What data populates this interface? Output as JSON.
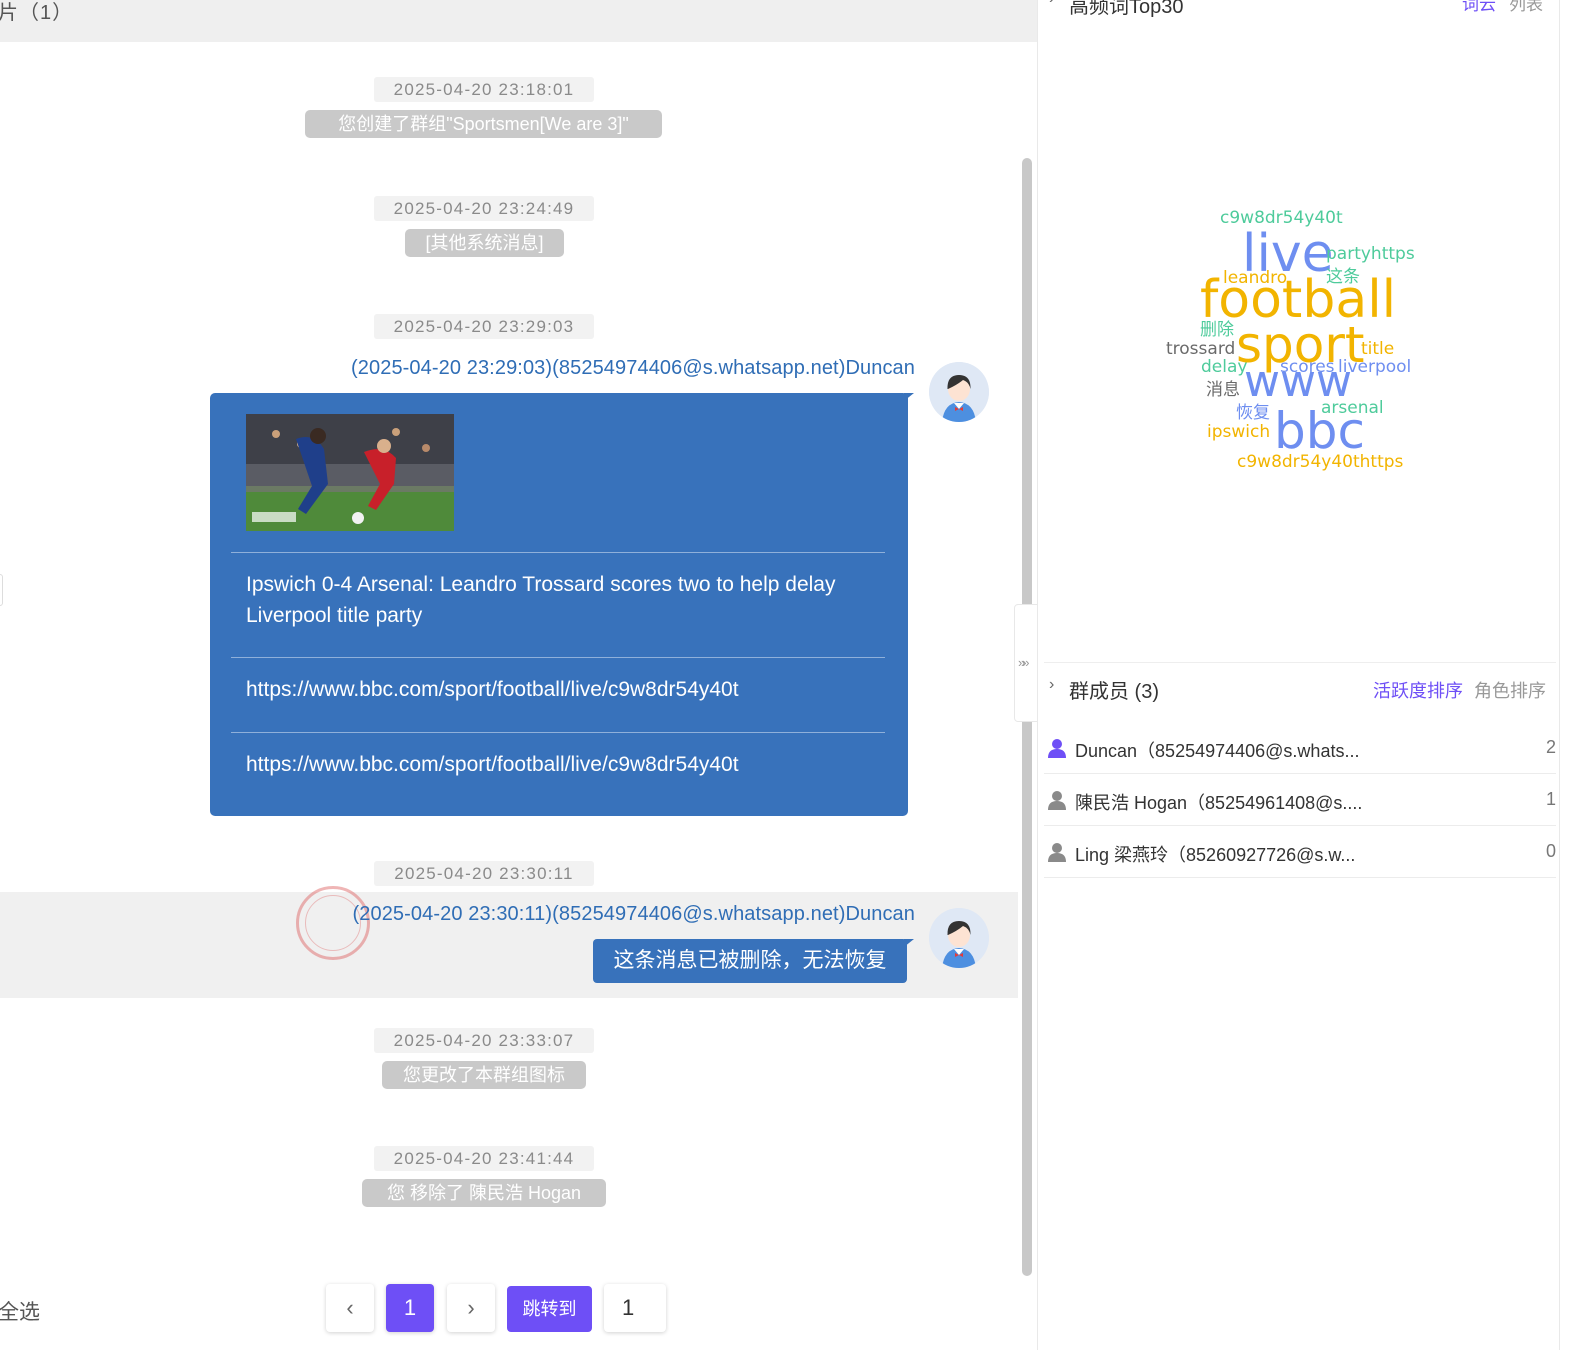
{
  "chat": {
    "header_text": "片（1）",
    "collapse_glyph": "»»",
    "messages": [
      {
        "time": "2025-04-20 23:18:01",
        "system": "您创建了群组\"Sportsmen[We are 3]\""
      },
      {
        "time": "2025-04-20 23:24:49",
        "system": "[其他系统消息]"
      },
      {
        "time": "2025-04-20 23:29:03",
        "sender": "(2025-04-20 23:29:03)(85254974406@s.whatsapp.net)Duncan",
        "link_card": {
          "title": "Ipswich 0-4 Arsenal: Leandro Trossard scores two to help delay Liverpool title party",
          "url_1": "https://www.bbc.com/sport/football/live/c9w8dr54y40t",
          "url_2": "https://www.bbc.com/sport/football/live/c9w8dr54y40t"
        }
      },
      {
        "time": "2025-04-20 23:30:11",
        "sender": "(2025-04-20 23:30:11)(85254974406@s.whatsapp.net)Duncan",
        "text": "这条消息已被删除，无法恢复"
      },
      {
        "time": "2025-04-20 23:33:07",
        "system": "您更改了本群组图标"
      },
      {
        "time": "2025-04-20 23:41:44",
        "system": "您 移除了 陳民浩 Hogan"
      }
    ]
  },
  "pagination": {
    "select_all": "全选",
    "prev_icon": "‹",
    "current_page": "1",
    "next_icon": "›",
    "jump_label": "跳转到",
    "jump_value": "1"
  },
  "wordcloud": {
    "title": "高频词Top30",
    "tab_cloud": "词云",
    "tab_list": "列表",
    "chevron": "›",
    "words": [
      {
        "text": "c9w8dr54y40t",
        "color": "#4ecb9b"
      },
      {
        "text": "live",
        "color": "#6e8ef0"
      },
      {
        "text": "partyhttps",
        "color": "#4ecb9b"
      },
      {
        "text": "leandro",
        "color": "#f2b400"
      },
      {
        "text": "这条",
        "color": "#4ecb9b"
      },
      {
        "text": "football",
        "color": "#f2b400"
      },
      {
        "text": "删除",
        "color": "#4ecb9b"
      },
      {
        "text": "trossard",
        "color": "#6a6a6a"
      },
      {
        "text": "sport",
        "color": "#f2b400"
      },
      {
        "text": "title",
        "color": "#f2b400"
      },
      {
        "text": "delay",
        "color": "#4ecb9b"
      },
      {
        "text": "scores",
        "color": "#6e8ef0"
      },
      {
        "text": "liverpool",
        "color": "#6e8ef0"
      },
      {
        "text": "消息",
        "color": "#6a6a6a"
      },
      {
        "text": "www",
        "color": "#6e8ef0"
      },
      {
        "text": "恢复",
        "color": "#6e8ef0"
      },
      {
        "text": "arsenal",
        "color": "#4ecb9b"
      },
      {
        "text": "ipswich",
        "color": "#f2b400"
      },
      {
        "text": "bbc",
        "color": "#6e8ef0"
      },
      {
        "text": "c9w8dr54y40thttps",
        "color": "#f2b400"
      }
    ]
  },
  "members": {
    "title": "群成员 (3)",
    "chevron": "›",
    "sort_activity": "活跃度排序",
    "sort_role": "角色排序",
    "list": [
      {
        "name": "Duncan（85254974406@s.whats...",
        "count": "2",
        "icon_color": "#6e4ff6"
      },
      {
        "name": "陳民浩 Hogan（85254961408@s....",
        "count": "1",
        "icon_color": "#8a8a8a"
      },
      {
        "name": "Ling 梁燕玲（85260927726@s.w...",
        "count": "0",
        "icon_color": "#8a8a8a"
      }
    ]
  },
  "colors": {
    "accent": "#6e4ff6",
    "bubble": "#3872bb",
    "sender_text": "#2f6db5"
  }
}
